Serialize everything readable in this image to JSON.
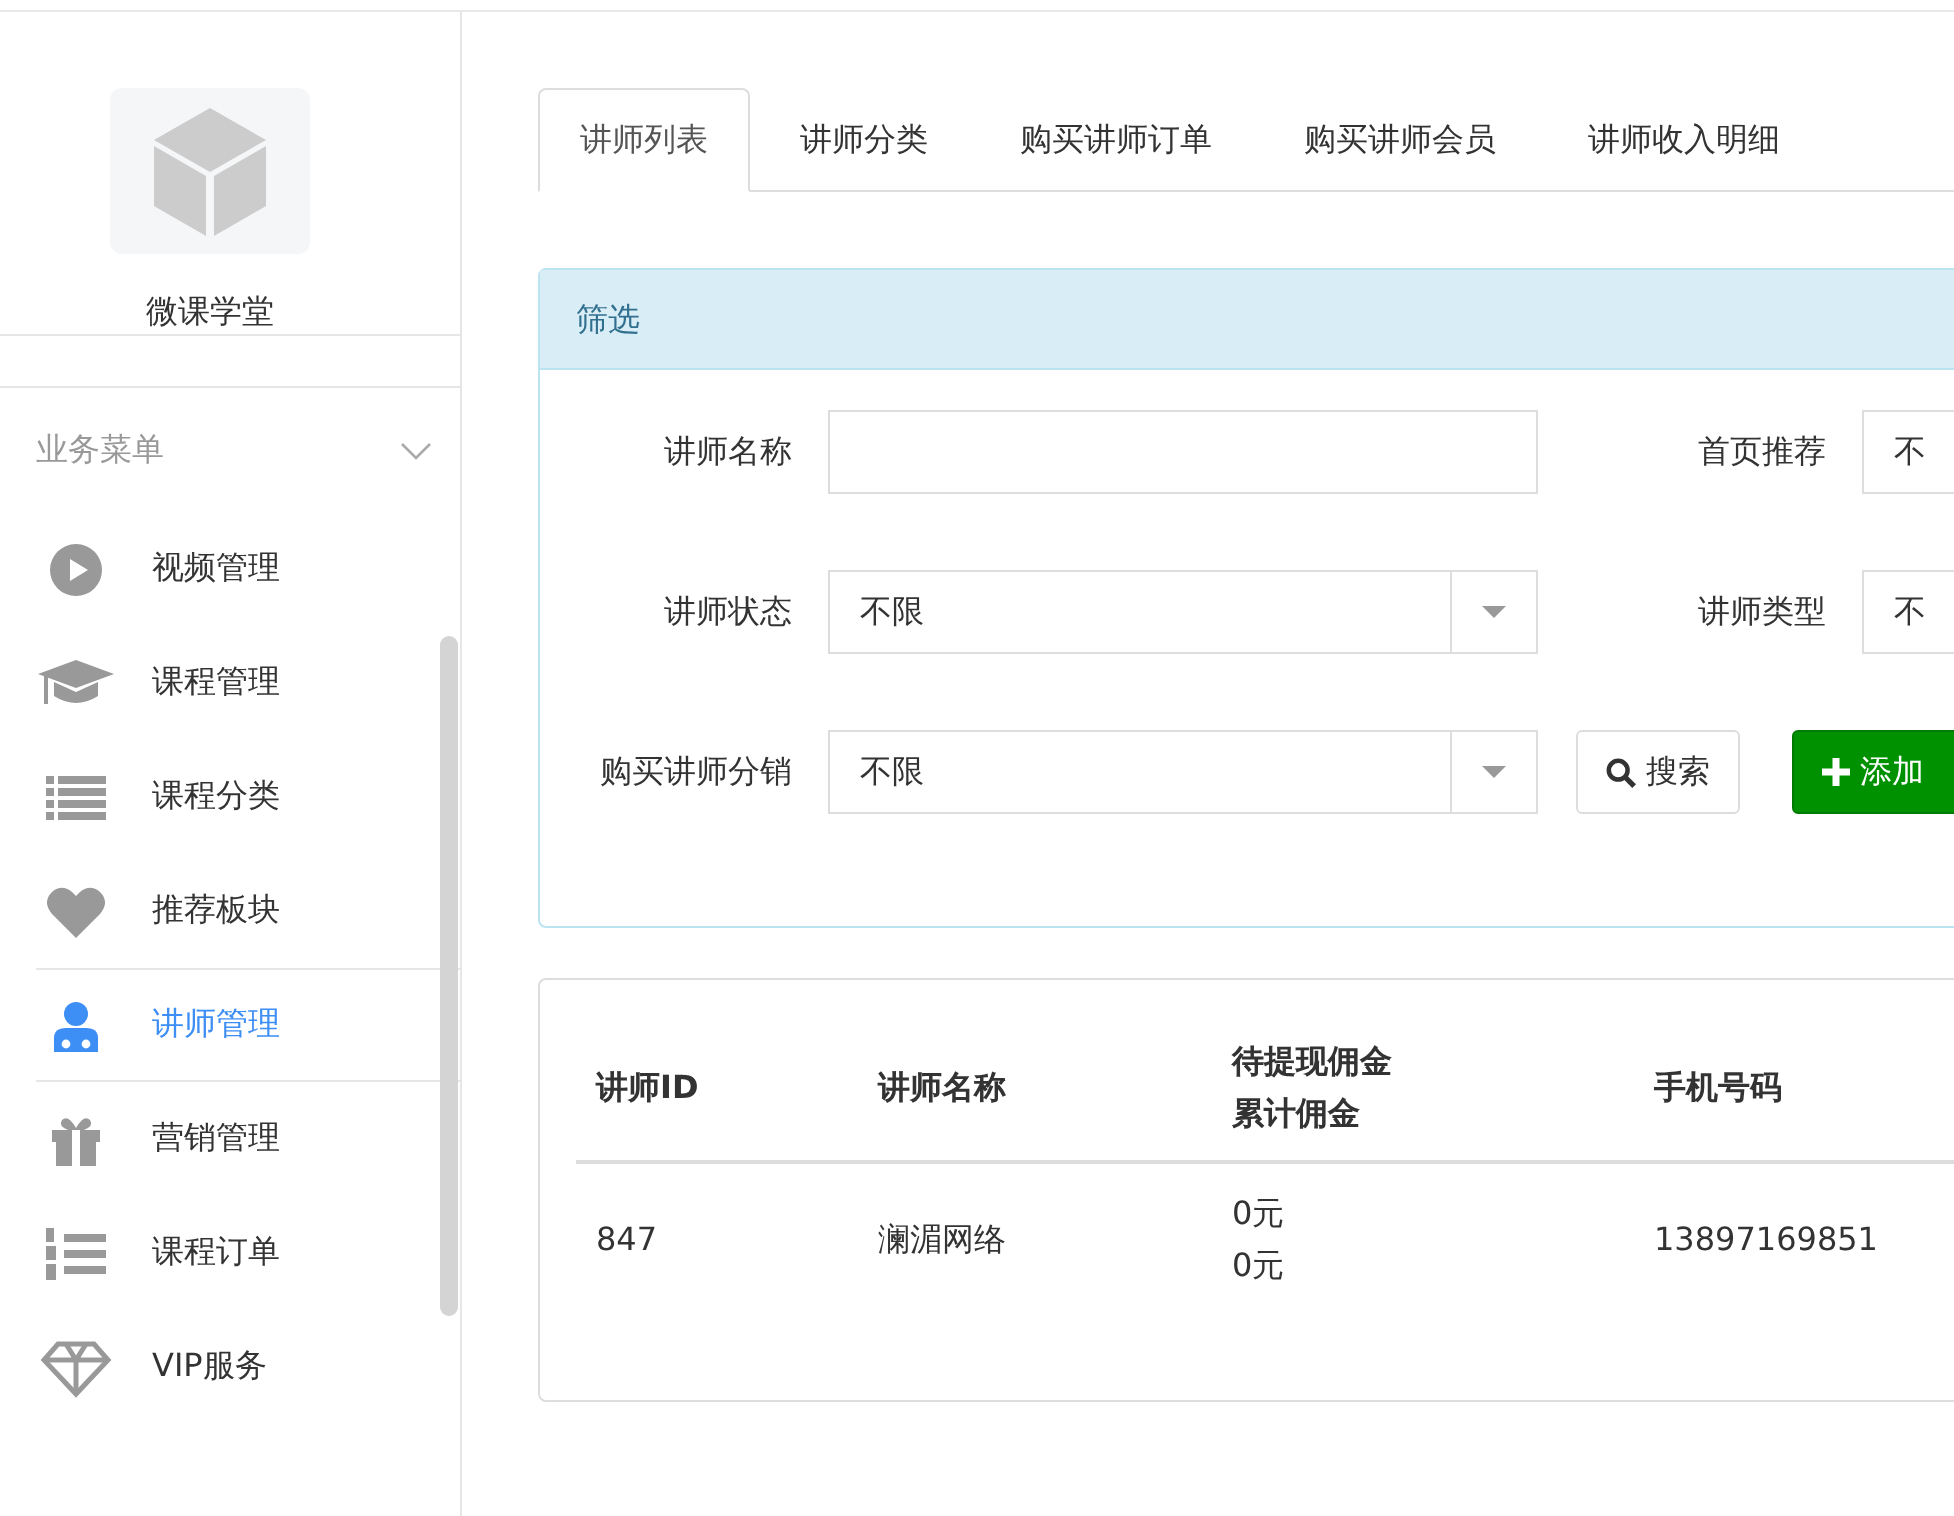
{
  "sidebar": {
    "brand": "微课学堂",
    "section": {
      "title": "业务菜单",
      "expanded": true
    },
    "items": [
      {
        "label": "视频管理",
        "selected": false
      },
      {
        "label": "课程管理",
        "selected": false
      },
      {
        "label": "课程分类",
        "selected": false
      },
      {
        "label": "推荐板块",
        "selected": false
      },
      {
        "label": "讲师管理",
        "selected": true
      },
      {
        "label": "营销管理",
        "selected": false
      },
      {
        "label": "课程订单",
        "selected": false
      },
      {
        "label": "VIP服务",
        "selected": false
      }
    ]
  },
  "tabs": [
    {
      "label": "讲师列表",
      "selected": true
    },
    {
      "label": "讲师分类",
      "selected": false
    },
    {
      "label": "购买讲师订单",
      "selected": false
    },
    {
      "label": "购买讲师会员",
      "selected": false
    },
    {
      "label": "讲师收入明细",
      "selected": false
    }
  ],
  "filter": {
    "title": "筛选",
    "fields": [
      {
        "label": "讲师名称",
        "kind": "text"
      },
      {
        "label": "首页推荐",
        "kind": "select",
        "value": "不"
      },
      {
        "label": "讲师状态",
        "kind": "select",
        "value": "不限"
      },
      {
        "label": "讲师类型",
        "kind": "select",
        "value": "不"
      },
      {
        "label": "购买讲师分销",
        "kind": "select",
        "value": "不限"
      }
    ],
    "buttons": [
      {
        "label": "搜索",
        "kind": "search"
      },
      {
        "label": "添加",
        "kind": "add"
      }
    ]
  },
  "table": {
    "columns": [
      {
        "label": "讲师ID"
      },
      {
        "label": "讲师名称"
      },
      {
        "label": "待提现佣金",
        "sublabel": "累计佣金"
      },
      {
        "label": "手机号码"
      }
    ],
    "rows": [
      {
        "cells": [
          {
            "text": "847"
          },
          {
            "text": "澜湄网络"
          },
          {
            "text": "0元",
            "subtext": "0元"
          },
          {
            "text": "13897169851"
          }
        ]
      }
    ]
  }
}
